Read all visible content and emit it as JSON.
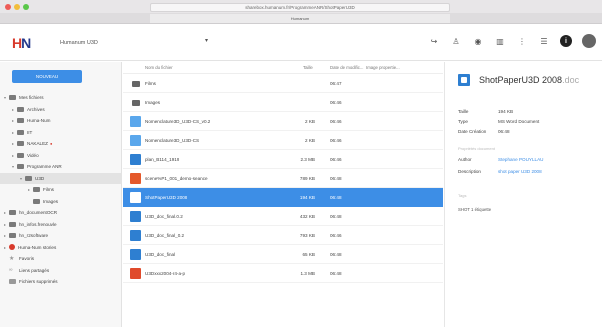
{
  "browser": {
    "url": "sharebox.humanum.fr/ProgrammeANR/ShotPaperU3D",
    "tab_title": "Humanum"
  },
  "app": {
    "breadcrumb": "Humanum U3D",
    "header_icons": [
      "share-icon",
      "add-user-icon",
      "eye-icon",
      "trash-icon",
      "more-icon",
      "grid-view-icon",
      "info-icon",
      "avatar-icon"
    ]
  },
  "sidebar": {
    "new_button": "NOUVEAU",
    "items": [
      {
        "label": "Mes fichiers",
        "depth": 0,
        "caret": "▾"
      },
      {
        "label": "Archives",
        "depth": 1,
        "caret": "▸"
      },
      {
        "label": "Huma-Num",
        "depth": 1,
        "caret": "▸"
      },
      {
        "label": "IIT",
        "depth": 1,
        "caret": "▸"
      },
      {
        "label": "NAKALEZ",
        "depth": 1,
        "caret": "▸",
        "badge": "●"
      },
      {
        "label": "Vidéo",
        "depth": 1,
        "caret": "▸"
      },
      {
        "label": "Programme ANR",
        "depth": 1,
        "caret": "▾"
      },
      {
        "label": "U3D",
        "depth": 2,
        "caret": "▾"
      },
      {
        "label": "Films",
        "depth": 3,
        "caret": "▸"
      },
      {
        "label": "Images",
        "depth": 3,
        "caret": ""
      },
      {
        "label": "hn_documentOCR",
        "depth": 0,
        "caret": "▸"
      },
      {
        "label": "hn_infos.frenouvle",
        "depth": 0,
        "caret": "▸"
      },
      {
        "label": "hn_r2software",
        "depth": 0,
        "caret": "▸"
      },
      {
        "label": "Huma-Num stories",
        "depth": 0,
        "caret": "▸",
        "icon": "red"
      },
      {
        "label": "Favoris",
        "depth": 0,
        "caret": "",
        "icon": "star"
      },
      {
        "label": "Liens partagés",
        "depth": 0,
        "caret": "",
        "icon": "link"
      },
      {
        "label": "Fichiers supprimés",
        "depth": 0,
        "caret": "",
        "icon": "trash"
      }
    ]
  },
  "list": {
    "headers": {
      "name": "Nom du fichier",
      "size": "Taille",
      "date": "Date de modific...",
      "prop": "Image propertie..."
    },
    "rows": [
      {
        "icon": "folder",
        "name": "Films",
        "size": "",
        "date": "06:47"
      },
      {
        "icon": "folder",
        "name": "Images",
        "size": "",
        "date": "06:46"
      },
      {
        "icon": "lite",
        "name": "Nomenclature3D_U3D-CS_v0.2",
        "size": "2 KB",
        "date": "06:46"
      },
      {
        "icon": "lite",
        "name": "Nomenclature3D_U3D-CS",
        "size": "2 KB",
        "date": "06:46"
      },
      {
        "icon": "doc",
        "name": "plan_B114_1919",
        "size": "2.3 MB",
        "date": "06:46"
      },
      {
        "icon": "ppt",
        "name": "scene%P1_001_demo-seance",
        "size": "789 KB",
        "date": "06:48"
      },
      {
        "icon": "doc",
        "name": "ShotPaperU3D 2008",
        "size": "194 KB",
        "date": "06:48",
        "selected": true
      },
      {
        "icon": "doc",
        "name": "U3D_doc_final.0.2",
        "size": "432 KB",
        "date": "06:48"
      },
      {
        "icon": "doc",
        "name": "U3D_doc_final_0.2",
        "size": "793 KB",
        "date": "06:46"
      },
      {
        "icon": "doc",
        "name": "U3D_doc_final",
        "size": "65 KB",
        "date": "06:48"
      },
      {
        "icon": "pdf",
        "name": "U3Dxxx2004-r4-a-p",
        "size": "1.3 MB",
        "date": "06:48"
      }
    ]
  },
  "details": {
    "title": "ShotPaperU3D 2008",
    "ext": ".doc",
    "rows": [
      {
        "label": "Taille",
        "value": "194 KB"
      },
      {
        "label": "Type",
        "value": "MS Word Document"
      },
      {
        "label": "Date Création",
        "value": "06:48"
      }
    ],
    "section": "Propriétés document",
    "props": [
      {
        "label": "Author",
        "value": "Stephane POUYLLAU"
      },
      {
        "label": "Description",
        "value": "shot paper U3D 2008"
      }
    ],
    "tags_label": "Tags",
    "tags": "SHOT  1 étiquette"
  }
}
